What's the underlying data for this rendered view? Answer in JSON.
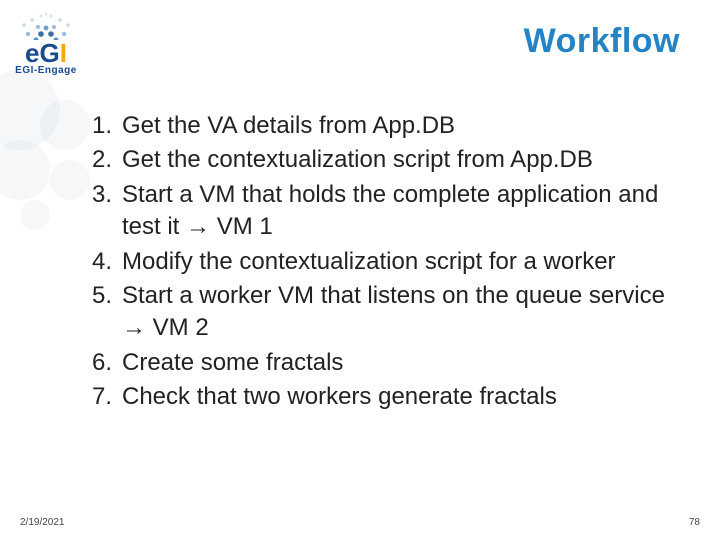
{
  "header": {
    "title": "Workflow",
    "logo": {
      "e": "e",
      "g": "G",
      "i": "I",
      "sub": "EGI-Engage"
    }
  },
  "list": {
    "items": [
      {
        "n": "1.",
        "text": "Get the VA details from App.DB"
      },
      {
        "n": "2.",
        "text": "Get the contextualization script from App.DB"
      },
      {
        "n": "3.",
        "text": "Start a VM that holds the complete application and test it → VM 1"
      },
      {
        "n": "4.",
        "text": "Modify the contextualization script for a worker"
      },
      {
        "n": "5.",
        "text": "Start a worker VM that listens on the queue service → VM 2"
      },
      {
        "n": "6.",
        "text": "Create some fractals"
      },
      {
        "n": "7.",
        "text": "Check that two workers generate fractals"
      }
    ]
  },
  "footer": {
    "date": "2/19/2021",
    "page": "78"
  }
}
